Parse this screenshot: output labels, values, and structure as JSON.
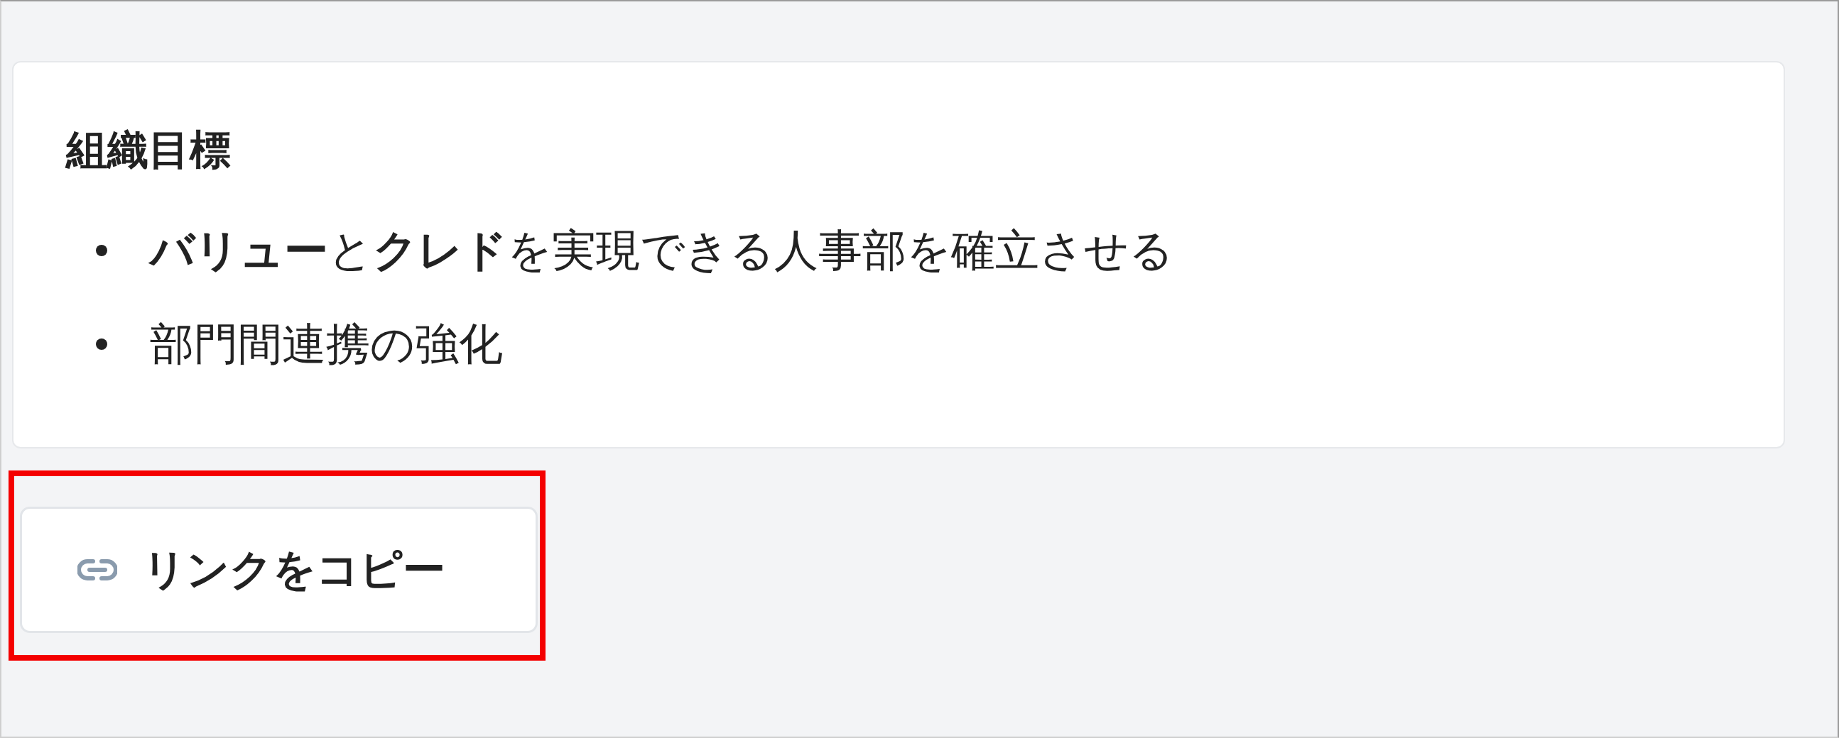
{
  "card": {
    "title": "組織目標",
    "items": [
      "**バリュー**と**クレド**を実現できる人事部を確立させる",
      "部門間連携の強化"
    ]
  },
  "copy_button": {
    "label": "リンクをコピー",
    "highlighted": true
  }
}
